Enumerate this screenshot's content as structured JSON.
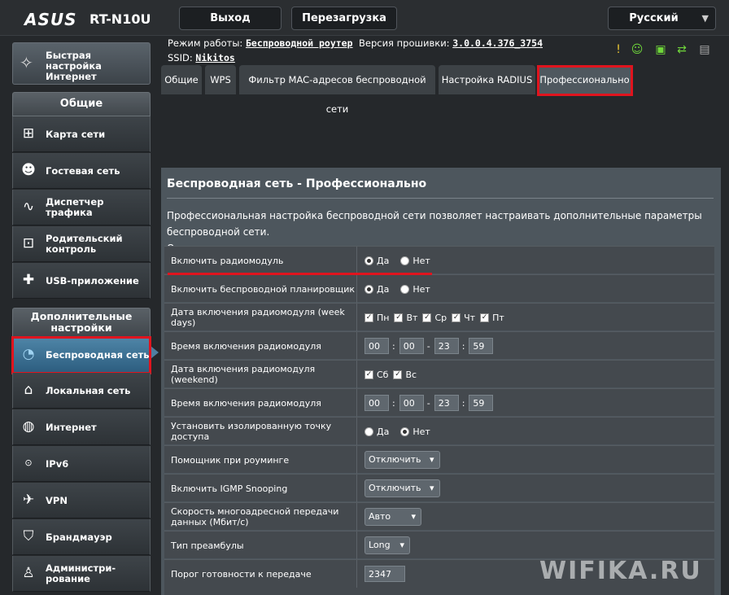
{
  "header": {
    "logo": "ASUS",
    "model": "RT-N10U",
    "logout": "Выход",
    "reboot": "Перезагрузка",
    "language": "Русский"
  },
  "info": {
    "mode_label": "Режим работы:",
    "mode_value": "Беспроводной роутер",
    "firmware_label": "Версия прошивки:",
    "firmware_value": "3.0.0.4.376_3754",
    "ssid_label": "SSID:",
    "ssid_value": "Nikitos"
  },
  "status_icons": [
    "warning-icon",
    "user-icon",
    "network-icon",
    "usb-icon",
    "printer-icon"
  ],
  "sidebar": {
    "quick_setup": "Быстрая настройка Интернет",
    "general_header": "Общие",
    "general_items": [
      {
        "label": "Карта сети",
        "icon": "network-map-icon"
      },
      {
        "label": "Гостевая сеть",
        "icon": "guest-network-icon"
      },
      {
        "label": "Диспетчер трафика",
        "icon": "traffic-manager-icon"
      },
      {
        "label": "Родительский контроль",
        "icon": "lock-icon"
      },
      {
        "label": "USB-приложение",
        "icon": "puzzle-icon"
      }
    ],
    "advanced_header": "Дополнительные настройки",
    "advanced_items": [
      {
        "label": "Беспроводная сеть",
        "icon": "wifi-icon"
      },
      {
        "label": "Локальная сеть",
        "icon": "home-icon"
      },
      {
        "label": "Интернет",
        "icon": "globe-icon"
      },
      {
        "label": "IPv6",
        "icon": "ipv6-icon"
      },
      {
        "label": "VPN",
        "icon": "vpn-icon"
      },
      {
        "label": "Брандмауэр",
        "icon": "firewall-icon"
      },
      {
        "label": "Администри-рование",
        "icon": "admin-icon"
      }
    ]
  },
  "tabs": [
    "Общие",
    "WPS",
    "Фильтр MAC-адресов беспроводной сети",
    "Настройка RADIUS",
    "Профессионально"
  ],
  "panel": {
    "title": "Беспроводная сеть - Профессионально",
    "desc1": "Профессиональная настройка беспроводной сети позволяет настраивать дополнительные параметры беспроводной сети.",
    "desc2": "Однако рекомендуется использовать значения по умолчанию."
  },
  "settings": {
    "radio_enable": {
      "label": "Включить радиомодуль",
      "yes": "Да",
      "no": "Нет",
      "selected": "yes"
    },
    "scheduler": {
      "label": "Включить беспроводной планировщик",
      "yes": "Да",
      "no": "Нет",
      "selected": "yes"
    },
    "weekdays": {
      "label": "Дата включения радиомодуля (week days)",
      "days": [
        "Пн",
        "Вт",
        "Ср",
        "Чт",
        "Пт"
      ]
    },
    "weekday_time": {
      "label": "Время включения радиомодуля",
      "start_h": "00",
      "start_m": "00",
      "end_h": "23",
      "end_m": "59"
    },
    "weekend": {
      "label": "Дата включения радиомодуля (weekend)",
      "days": [
        "Сб",
        "Вс"
      ]
    },
    "weekend_time": {
      "label": "Время включения радиомодуля",
      "start_h": "00",
      "start_m": "00",
      "end_h": "23",
      "end_m": "59"
    },
    "isolation": {
      "label": "Установить изолированную точку доступа",
      "yes": "Да",
      "no": "Нет",
      "selected": "no"
    },
    "roaming": {
      "label": "Помощник при роуминге",
      "value": "Отключить"
    },
    "igmp": {
      "label": "Включить IGMP Snooping",
      "value": "Отключить"
    },
    "multicast": {
      "label": "Скорость многоадресной передачи данных (Мбит/с)",
      "value": "Авто"
    },
    "preamble": {
      "label": "Тип преамбулы",
      "value": "Long"
    },
    "rts": {
      "label": "Порог готовности к передаче",
      "value": "2347"
    }
  },
  "watermark": "WIFIKA.RU"
}
